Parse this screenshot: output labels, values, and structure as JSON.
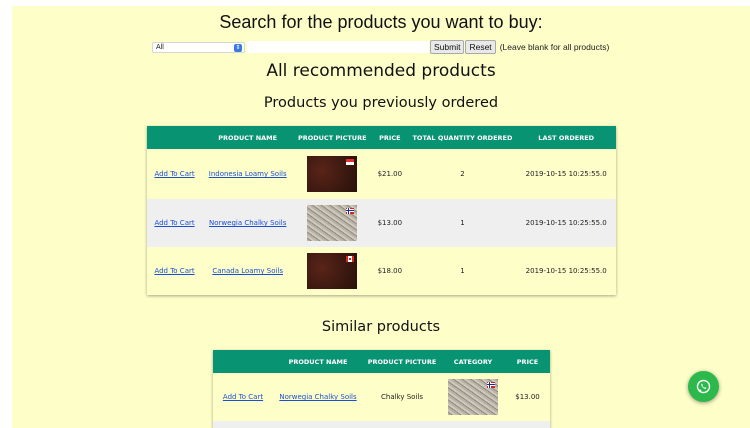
{
  "search": {
    "title": "Search for the products you want to buy:",
    "category_selected": "All",
    "query_value": "",
    "submit_label": "Submit",
    "reset_label": "Reset",
    "hint": "(Leave blank for all products)"
  },
  "all_recommended_heading": "All recommended products",
  "ordered": {
    "heading": "Products you previously ordered",
    "headers": [
      "",
      "PRODUCT NAME",
      "PRODUCT PICTURE",
      "PRICE",
      "TOTAL QUANTITY ORDERED",
      "LAST ORDERED"
    ],
    "rows": [
      {
        "action": "Add To Cart",
        "name": "Indonesia Loamy Soils",
        "picture": "loamy-soil-indonesia-flag",
        "price": "$21.00",
        "qty": "2",
        "last": "2019-10-15 10:25:55.0"
      },
      {
        "action": "Add To Cart",
        "name": "Norwegia Chalky Soils",
        "picture": "chalky-soil-norway-flag",
        "price": "$13.00",
        "qty": "1",
        "last": "2019-10-15 10:25:55.0"
      },
      {
        "action": "Add To Cart",
        "name": "Canada Loamy Soils",
        "picture": "loamy-soil-canada-flag",
        "price": "$18.00",
        "qty": "1",
        "last": "2019-10-15 10:25:55.0"
      }
    ]
  },
  "similar": {
    "heading": "Similar products",
    "headers": [
      "",
      "PRODUCT NAME",
      "PRODUCT PICTURE",
      "CATEGORY",
      "PRICE"
    ],
    "rows": [
      {
        "action": "Add To Cart",
        "name": "Norwegia Chalky Soils",
        "category": "Chalky Soils",
        "picture": "chalky-soil-norway-flag",
        "price": "$13.00"
      }
    ]
  },
  "colors": {
    "page_bg": "#fefec9",
    "table_header": "#089372",
    "row_alt": "#efefef",
    "link": "#1a4fd6",
    "whatsapp": "#2db84c"
  },
  "icons": {
    "chat": "whatsapp-icon",
    "select": "chevron-updown-icon"
  }
}
